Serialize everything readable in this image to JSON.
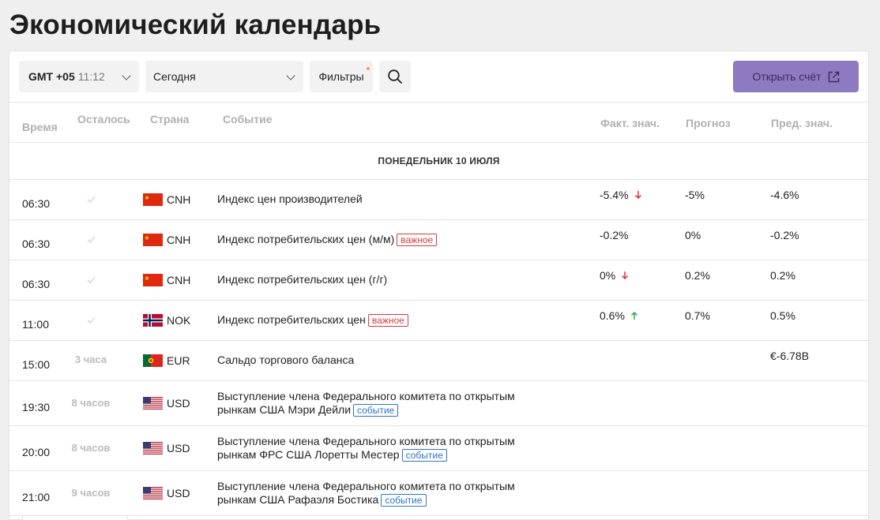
{
  "page": {
    "title": "Экономический календарь"
  },
  "toolbar": {
    "tz_label": "GMT +05",
    "tz_time": "11:12",
    "date_value": "Сегодня",
    "filters_label": "Фильтры",
    "open_account_label": "Открыть счёт",
    "accent_color": "#8e7ac0"
  },
  "table": {
    "headers": {
      "time": "Время",
      "left": "Осталось",
      "country": "Страна",
      "event": "Событие",
      "actual": "Факт. знач.",
      "forecast": "Прогноз",
      "previous": "Пред. знач."
    },
    "day_label": "ПОНЕДЕЛЬНИК 10 ИЮЛЯ",
    "badges": {
      "important": "важное",
      "event": "событие"
    },
    "rows": [
      {
        "time": "06:30",
        "left": "",
        "country": "CNH",
        "flag": "cn",
        "event": "Индекс цен производителей",
        "actual": "-5.4%",
        "trend": "down",
        "forecast": "-5%",
        "previous": "-4.6%"
      },
      {
        "time": "06:30",
        "left": "",
        "country": "CNH",
        "flag": "cn",
        "event": "Индекс потребительских цен (м/м)",
        "badge": "important",
        "actual": "-0.2%",
        "forecast": "0%",
        "previous": "-0.2%"
      },
      {
        "time": "06:30",
        "left": "",
        "country": "CNH",
        "flag": "cn",
        "event": "Индекс потребительских цен (г/г)",
        "actual": "0%",
        "trend": "down",
        "forecast": "0.2%",
        "previous": "0.2%"
      },
      {
        "time": "11:00",
        "left": "",
        "country": "NOK",
        "flag": "no",
        "event": "Индекс потребительских цен",
        "badge": "important",
        "actual": "0.6%",
        "trend": "up",
        "forecast": "0.7%",
        "previous": "0.5%"
      },
      {
        "time": "15:00",
        "left": "3 часа",
        "country": "EUR",
        "flag": "pt",
        "event": "Сальдо торгового баланса",
        "actual": "",
        "forecast": "",
        "previous": "€-6.78B"
      },
      {
        "time": "19:30",
        "left": "8 часов",
        "country": "USD",
        "flag": "us",
        "event_line1": "Выступление члена Федерального комитета по открытым",
        "event_line2": "рынкам США Мэри Дейли",
        "badge": "event"
      },
      {
        "time": "20:00",
        "left": "8 часов",
        "country": "USD",
        "flag": "us",
        "event_line1": "Выступление члена Федерального комитета по открытым",
        "event_line2": "рынкам ФРС США Лоретты Местер",
        "badge": "event"
      },
      {
        "time": "21:00",
        "left": "9 часов",
        "country": "USD",
        "flag": "us",
        "event_line1": "Выступление члена Федерального комитета по открытым",
        "event_line2": "рынкам США Рафаэля Бостика",
        "badge": "event"
      }
    ]
  }
}
